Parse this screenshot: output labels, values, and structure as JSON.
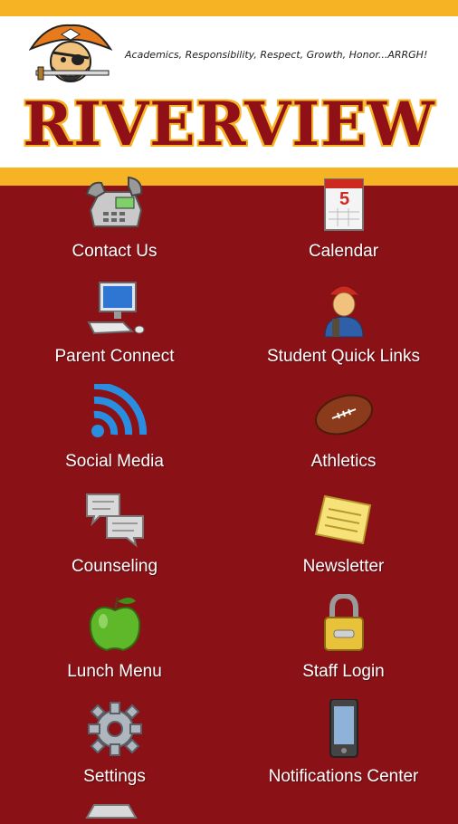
{
  "header": {
    "motto": "Academics, Responsibility, Respect, Growth, Honor...ARRGH!",
    "school_name": "RIVERVIEW",
    "logo_icon": "pirate-mascot-icon"
  },
  "colors": {
    "background": "#8a1116",
    "accent_gold": "#f6b324",
    "label_text": "#ffffff"
  },
  "tiles": [
    {
      "label": "Contact Us",
      "icon": "telephone-icon"
    },
    {
      "label": "Calendar",
      "icon": "calendar-icon",
      "calendar_day": "5"
    },
    {
      "label": "Parent Connect",
      "icon": "computer-icon"
    },
    {
      "label": "Student Quick Links",
      "icon": "student-icon"
    },
    {
      "label": "Social Media",
      "icon": "wifi-signal-icon"
    },
    {
      "label": "Athletics",
      "icon": "football-icon"
    },
    {
      "label": "Counseling",
      "icon": "chat-bubbles-icon"
    },
    {
      "label": "Newsletter",
      "icon": "note-paper-icon"
    },
    {
      "label": "Lunch Menu",
      "icon": "apple-icon"
    },
    {
      "label": "Staff Login",
      "icon": "padlock-icon"
    },
    {
      "label": "Settings",
      "icon": "gear-icon"
    },
    {
      "label": "Notifications Center",
      "icon": "mobile-phone-icon"
    }
  ]
}
